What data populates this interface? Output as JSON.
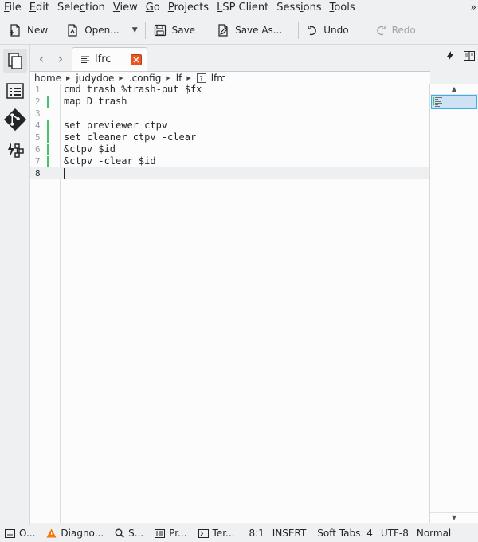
{
  "menubar": {
    "items": [
      {
        "mnemonic": "F",
        "rest": "ile"
      },
      {
        "mnemonic": "E",
        "rest": "dit"
      },
      {
        "pre": "Sele",
        "mnemonic": "c",
        "rest": "tion"
      },
      {
        "mnemonic": "V",
        "rest": "iew"
      },
      {
        "mnemonic": "G",
        "rest": "o"
      },
      {
        "mnemonic": "P",
        "rest": "rojects"
      },
      {
        "mnemonic": "L",
        "rest": "SP Client"
      },
      {
        "pre": "Sess",
        "mnemonic": "i",
        "rest": "ons"
      },
      {
        "mnemonic": "T",
        "rest": "ools"
      }
    ],
    "overflow": "»"
  },
  "toolbar": {
    "new_label": "New",
    "open_label": "Open...",
    "save_label": "Save",
    "save_as_label": "Save As...",
    "undo_label": "Undo",
    "redo_label": "Redo"
  },
  "tab": {
    "label": "lfrc"
  },
  "breadcrumb": [
    "home",
    "judydoe",
    ".config",
    "lf",
    "lfrc"
  ],
  "editor": {
    "lines": [
      {
        "num": "1",
        "text": "cmd trash %trash-put $fx",
        "modified": false
      },
      {
        "num": "2",
        "text": "map D trash",
        "modified": true
      },
      {
        "num": "3",
        "text": "",
        "modified": false
      },
      {
        "num": "4",
        "text": "set previewer ctpv",
        "modified": true
      },
      {
        "num": "5",
        "text": "set cleaner ctpv -clear",
        "modified": true
      },
      {
        "num": "6",
        "text": "&ctpv $id",
        "modified": true
      },
      {
        "num": "7",
        "text": "&ctpv -clear $id",
        "modified": true
      },
      {
        "num": "8",
        "text": "",
        "modified": false
      }
    ],
    "current_line": 8
  },
  "statusbar": {
    "output_label": "O...",
    "diagnostics_label": "Diagno...",
    "search_label": "S...",
    "projects_label": "Pr...",
    "terminal_label": "Ter...",
    "cursor_position": "8:1",
    "mode": "INSERT",
    "indent": "Soft Tabs: 4",
    "encoding": "UTF-8",
    "input_mode": "Normal"
  },
  "colors": {
    "accent": "#3daee9",
    "modified_marker": "#3fc66a",
    "close_button": "#e95420",
    "warning": "#f67400"
  }
}
